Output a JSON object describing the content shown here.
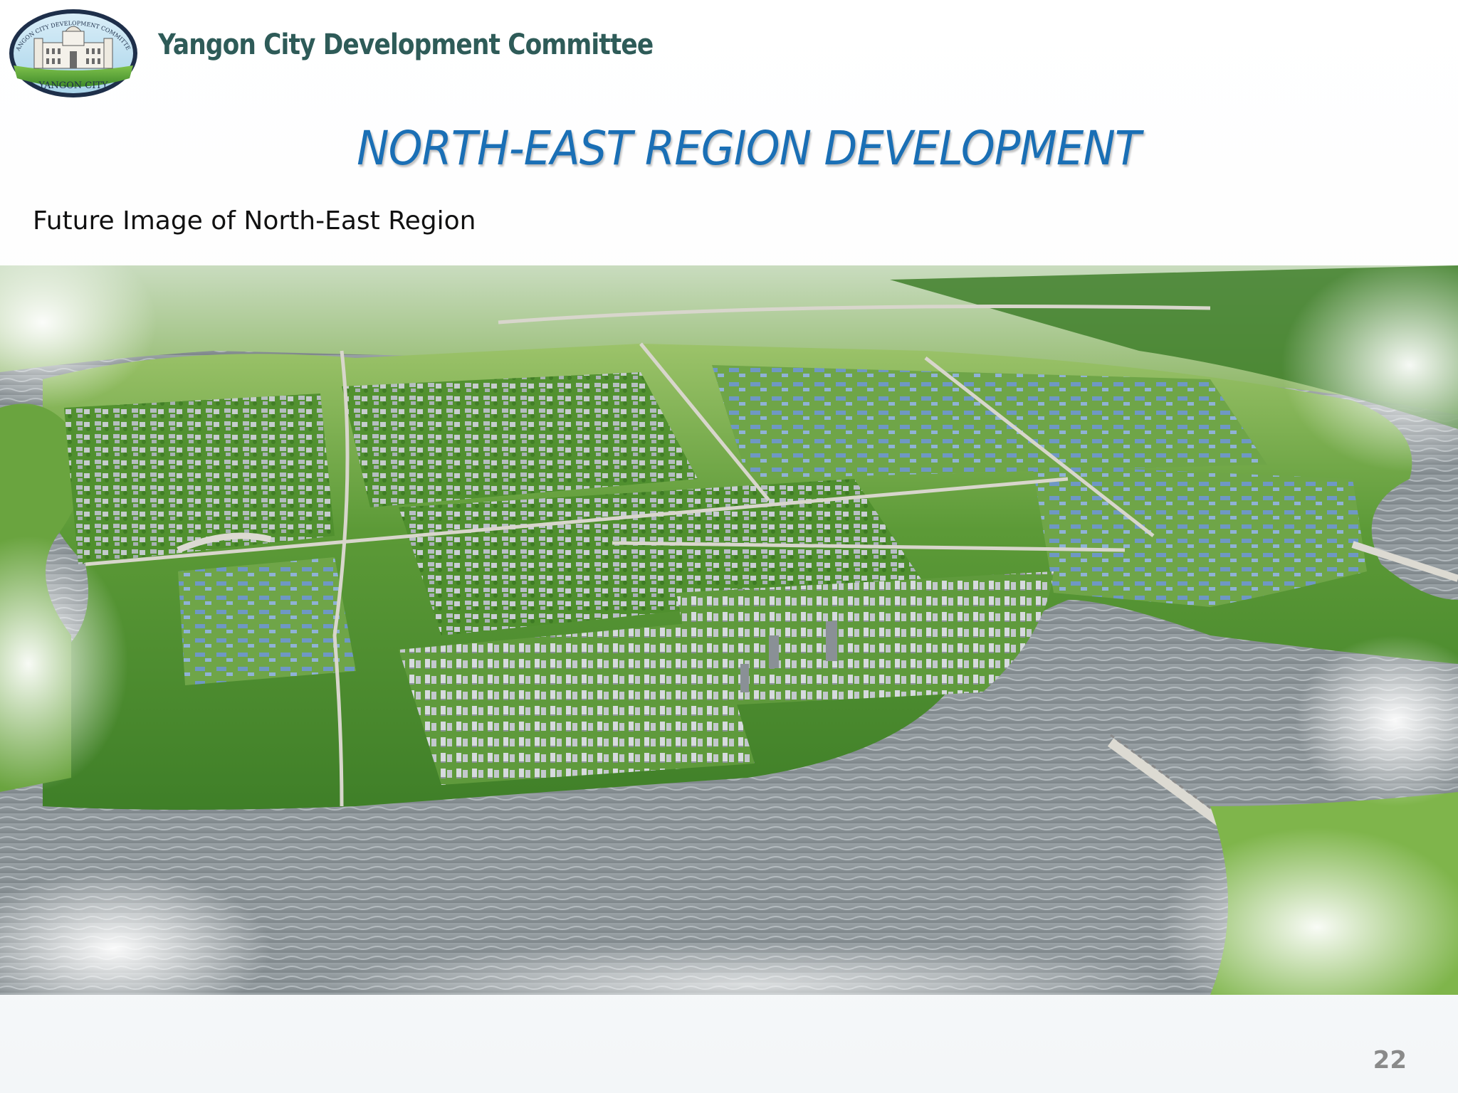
{
  "header": {
    "organization": "Yangon City Development Committee",
    "logo_label": "YANGON CITY",
    "logo_ring_text": "YANGON CITY DEVELOPMENT COMMITTEE"
  },
  "slide": {
    "title": "NORTH-EAST REGION DEVELOPMENT",
    "subtitle": "Future Image of North-East Region",
    "page_number": "22"
  },
  "colors": {
    "org_text": "#2e5b58",
    "title_text": "#1a6fb5",
    "river": "#8f969a",
    "vegetation": "#4f8f2e"
  }
}
